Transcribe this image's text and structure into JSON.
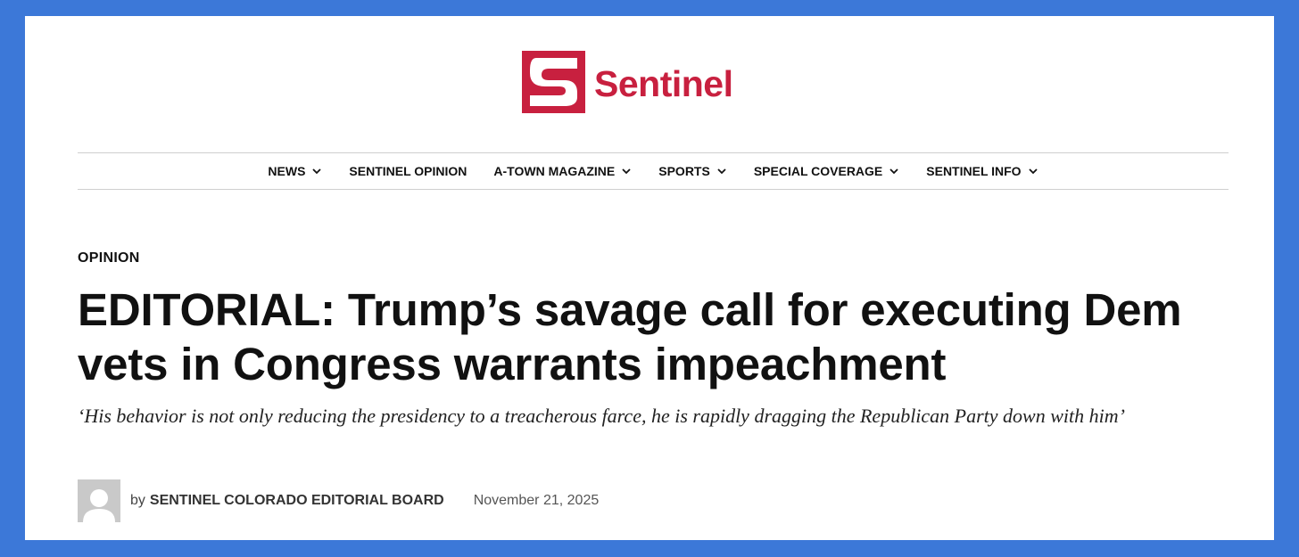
{
  "brand": {
    "name": "Sentinel",
    "color": "#c8203f"
  },
  "nav": {
    "items": [
      {
        "label": "NEWS",
        "has_dropdown": true
      },
      {
        "label": "SENTINEL OPINION",
        "has_dropdown": false
      },
      {
        "label": "A-TOWN MAGAZINE",
        "has_dropdown": true
      },
      {
        "label": "SPORTS",
        "has_dropdown": true
      },
      {
        "label": "SPECIAL COVERAGE",
        "has_dropdown": true
      },
      {
        "label": "SENTINEL INFO",
        "has_dropdown": true
      }
    ]
  },
  "article": {
    "category": "OPINION",
    "headline": "EDITORIAL: Trump’s savage call for executing Dem vets in Congress warrants impeachment",
    "subheadline": "‘His behavior is not only reducing the presidency to a treacherous farce, he is rapidly dragging the Republican Party down with him’",
    "byline_prefix": "by",
    "author": "SENTINEL COLORADO EDITORIAL BOARD",
    "date": "November 21, 2025"
  },
  "colors": {
    "frame": "#3c78d8",
    "text": "#111111"
  }
}
